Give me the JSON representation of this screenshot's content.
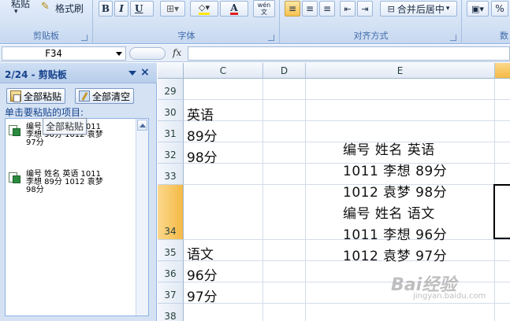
{
  "ribbon": {
    "paste_label": "粘贴",
    "format_painter_label": "格式刷",
    "clipboard_group": "剪贴板",
    "font_group": "字体",
    "alignment_group": "对齐方式",
    "number_group_partial": "数",
    "bold": "B",
    "italic": "I",
    "underline": "U",
    "font_color_letter": "A",
    "wen_label": "wén\n文",
    "merge_center_label": "合并后居中",
    "percent": "%"
  },
  "formula_bar": {
    "name_box": "F34",
    "fx": "fx",
    "formula": ""
  },
  "clipboard_pane": {
    "title": "2/24 - 剪贴板",
    "close": "×",
    "paste_all": "全部粘贴",
    "clear_all": "全部清空",
    "hint": "单击要粘贴的项目:",
    "tooltip": "全部粘贴",
    "items": [
      "编号 姓名 语文 1011\n李想 96分 1012 袁梦\n97分",
      "编号 姓名 英语 1011\n李想 89分 1012 袁梦\n98分"
    ]
  },
  "grid": {
    "columns": [
      "C",
      "D",
      "E"
    ],
    "selected_column": "F",
    "rows": [
      "29",
      "30",
      "31",
      "32",
      "33",
      "34",
      "35",
      "36",
      "37",
      "38"
    ],
    "selected_row": "34",
    "cells_c": {
      "30": "英语",
      "31": "89分",
      "32": "98分",
      "35": "语文",
      "36": "96分",
      "37": "97分"
    },
    "pasted_block": [
      "编号  姓名  英语",
      "1011  李想  89分",
      "1012  袁梦  98分",
      "编号  姓名  语文",
      "1011  李想  96分",
      "1012  袁梦  97分"
    ]
  },
  "watermark": {
    "main": "Bai经验",
    "sub": "jingyan.baidu.com"
  },
  "colors": {
    "ribbon_bg": "#d3e1f4",
    "selection_orange": "#f5b945",
    "header_bg": "#e1e9f4"
  }
}
